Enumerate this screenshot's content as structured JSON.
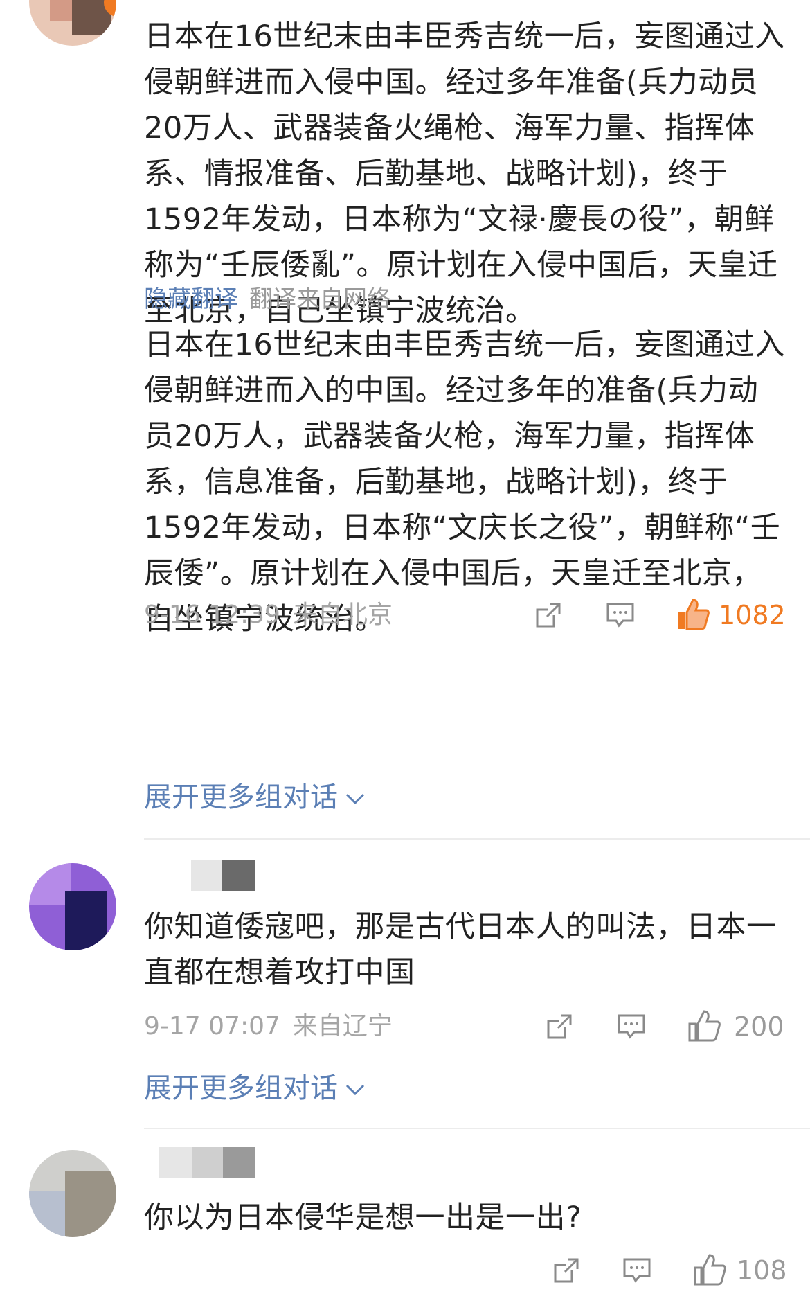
{
  "comments": [
    {
      "body": "日本在16世纪末由丰臣秀吉统一后，妄图通过入侵朝鲜进而入侵中国。经过多年准备(兵力动员20万人、武器装备火绳枪、海军力量、指挥体系、情报准备、后勤基地、战略计划)，终于1592年发动，日本称为“文禄·慶長の役”，朝鲜称为“壬辰倭亂”。原计划在入侵中国后，天皇迁至北京，自己坐镇宁波统治。",
      "hide_translation": "隐藏翻译",
      "translation_source": "翻译来自网络",
      "translation": "日本在16世纪末由丰臣秀吉统一后，妄图通过入侵朝鲜进而入的中国。经过多年的准备(兵力动员20万人，武器装备火枪，海军力量，指挥体系，信息准备，后勤基地，战略计划)，终于1592年发动，日本称“文庆长之役”，朝鲜称“壬辰倭”。原计划在入侵中国后，天皇迁至北京，自坐镇宁波统治。",
      "time": "9-16 12:39",
      "location": "来自北京",
      "likes": "1082",
      "expand_label": "展开更多组对话"
    },
    {
      "body": "你知道倭寇吧，那是古代日本人的叫法，日本一直都在想着攻打中国",
      "time": "9-17 07:07",
      "location": "来自辽宁",
      "likes": "200",
      "expand_label": "展开更多组对话"
    },
    {
      "body": "你以为日本侵华是想一出是一出?",
      "likes": "108"
    }
  ],
  "icons": {
    "share": "share-icon",
    "reply": "comment-icon",
    "like": "thumbs-up-icon",
    "expand": "chevron-down-icon"
  },
  "colors": {
    "link": "#5b7fb5",
    "like_active": "#f07a22",
    "meta": "#a5a5a5"
  }
}
